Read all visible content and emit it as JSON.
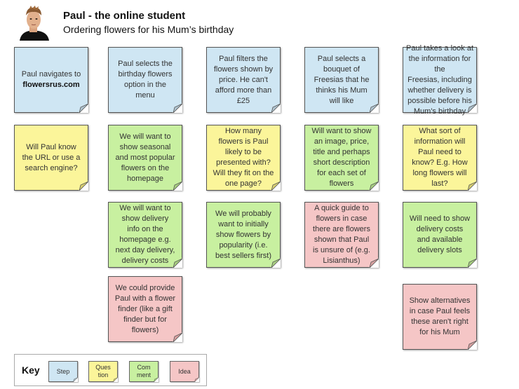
{
  "header": {
    "title": "Paul - the online student",
    "subtitle": "Ordering flowers for his Mum’s birthday",
    "avatar_icon": "person-portrait-icon"
  },
  "colors": {
    "step": "#cfe6f3",
    "question": "#fbf59a",
    "comment": "#c8f0a0",
    "idea": "#f5c6c6"
  },
  "columns": [
    {
      "step": {
        "line1": "Paul navigates to",
        "line2_bold": "flowersrus.com"
      },
      "notes": [
        {
          "type": "question",
          "text": "Will Paul know\nthe URL or use a\nsearch engine?"
        }
      ]
    },
    {
      "step": {
        "text": "Paul selects the\nbirthday flowers\noption in the\nmenu"
      },
      "notes": [
        {
          "type": "comment",
          "text": "We will want to\nshow seasonal\nand most popular\nflowers on the\nhomepage"
        },
        {
          "type": "comment",
          "text": "We will want to\nshow delivery\ninfo on the\nhomepage e.g.\nnext day delivery,\ndelivery costs"
        },
        {
          "type": "idea",
          "text": "We could provide\nPaul with a flower\nfinder (like a gift\nfinder but for\nflowers)"
        }
      ]
    },
    {
      "step": {
        "text": "Paul filters the\nflowers shown by\nprice. He can't\nafford more than\n£25"
      },
      "notes": [
        {
          "type": "question",
          "text": "How many\nflowers is Paul\nlikely to be\npresented with?\nWill they fit on the\none page?"
        },
        {
          "type": "comment",
          "text": "We will probably\nwant to initially\nshow flowers by\npopularity (i.e.\nbest sellers first)"
        }
      ]
    },
    {
      "step": {
        "text": "Paul selects a\nbouquet of\nFreesias that he\nthinks his Mum\nwill like"
      },
      "notes": [
        {
          "type": "comment",
          "text": "Will want to show\nan image, price,\ntitle and perhaps\nshort description\nfor each set of\nflowers"
        },
        {
          "type": "idea",
          "text": "A quick guide to\nflowers in case\nthere are flowers\nshown that Paul\nis unsure of (e.g.\nLisianthus)"
        }
      ]
    },
    {
      "step": {
        "text": "Paul takes a look at\nthe information for the\nFreesias, including\nwhether delivery is\npossible before his\nMum's birthday"
      },
      "notes": [
        {
          "type": "question",
          "text": "What sort of\ninformation will\nPaul need to\nknow? E.g. How\nlong flowers will\nlast?"
        },
        {
          "type": "comment",
          "text": "Will need to show\ndelivery costs\nand available\ndelivery slots"
        },
        {
          "type": "idea",
          "text": "Show alternatives\nin case Paul feels\nthese aren't right\nfor his Mum"
        }
      ]
    }
  ],
  "key": {
    "label": "Key",
    "items": [
      {
        "type": "step",
        "label": "Step"
      },
      {
        "type": "question",
        "label": "Ques\ntion"
      },
      {
        "type": "comment",
        "label": "Com\nment"
      },
      {
        "type": "idea",
        "label": "Idea"
      }
    ]
  }
}
